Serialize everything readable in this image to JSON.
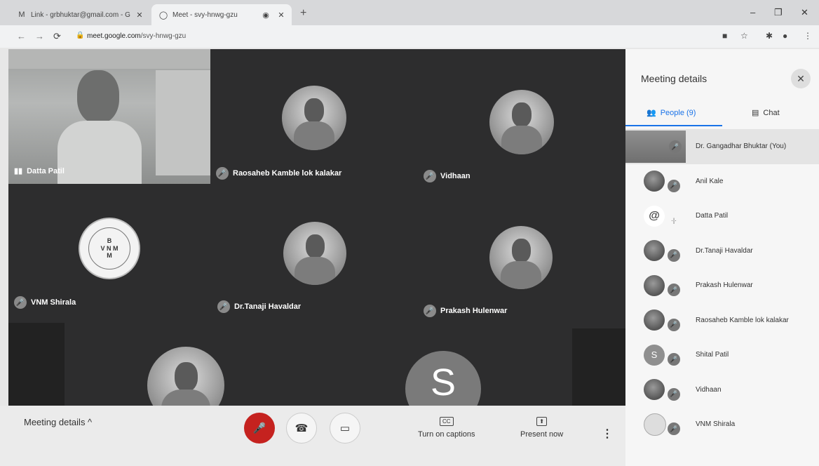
{
  "browser": {
    "tabs": [
      {
        "icon": "M",
        "title": "Link - grbhuktar@gmail.com - G"
      },
      {
        "icon": "◯",
        "title": "Meet - svy-hnwg-gzu"
      }
    ],
    "new_tab": "+",
    "url_host": "meet.google.com",
    "url_path": "/svy-hnwg-gzu",
    "window_controls": {
      "minimize": "–",
      "restore": "❐",
      "close": "✕"
    }
  },
  "stage": {
    "self_name": "Datta Patil",
    "tiles": [
      {
        "name": "Raosaheb Kamble lok kalakar"
      },
      {
        "name": "Vidhaan"
      },
      {
        "name": "VNM Shirala"
      },
      {
        "name": "Dr.Tanaji Havaldar"
      },
      {
        "name": "Prakash Hulenwar"
      }
    ],
    "logo_lines": [
      "B",
      "V N M",
      "M"
    ],
    "presenter_letter": "S"
  },
  "controls": {
    "meeting_details": "Meeting details ^",
    "captions": "Turn on captions",
    "captions_icon": "CC",
    "present": "Present now"
  },
  "panel": {
    "title": "Meeting details",
    "people_tab": "People (9)",
    "chat_tab": "Chat",
    "participants": [
      {
        "name": "Dr. Gangadhar Bhuktar (You)"
      },
      {
        "name": "Anil Kale"
      },
      {
        "name": "Datta Patil"
      },
      {
        "name": "Dr.Tanaji Havaldar"
      },
      {
        "name": "Prakash Hulenwar"
      },
      {
        "name": "Raosaheb Kamble lok kalakar"
      },
      {
        "name": "Shital Patil",
        "letter": "S"
      },
      {
        "name": "Vidhaan"
      },
      {
        "name": "VNM Shirala"
      }
    ]
  },
  "colors": {
    "end_call": "#c5221f",
    "accent": "#1a73e8",
    "stage_bg": "#2d2d2e"
  }
}
